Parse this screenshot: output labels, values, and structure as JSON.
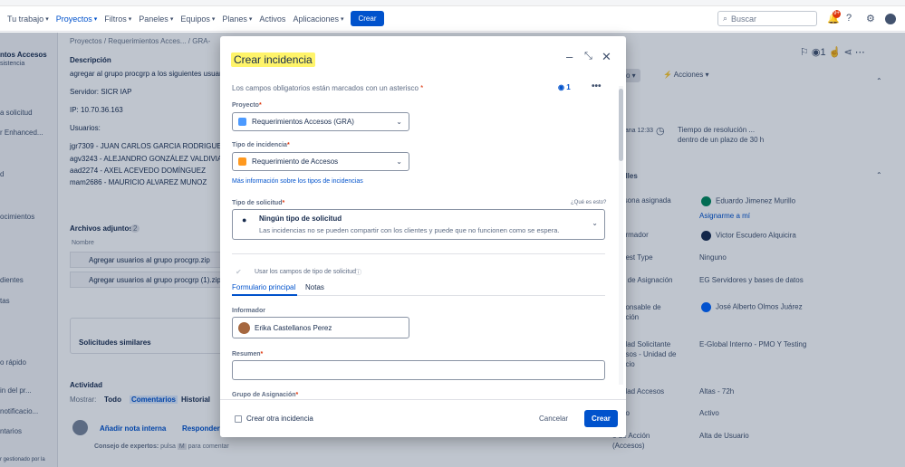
{
  "topnav": {
    "items": [
      "Tu trabajo",
      "Proyectos",
      "Filtros",
      "Paneles",
      "Equipos",
      "Planes",
      "Activos",
      "Aplicaciones"
    ],
    "create_label": "Crear",
    "search_placeholder": "Buscar",
    "notif_count": "9+"
  },
  "left_sidebar": {
    "items": [
      "ntos Accesos",
      "sistencia",
      "a solicitud",
      "r Enhanced...",
      "d",
      "ocimientos",
      "dientes",
      "tas",
      "o rápido",
      "in del pr...",
      "notificacio...",
      "ntarios",
      "r gestionado por la"
    ]
  },
  "main": {
    "breadcrumb": [
      "Proyectos",
      "/",
      "Requerimientos Acces...",
      "/",
      "GRA-"
    ],
    "description_label": "Descripción",
    "description_lines": [
      "agregar al grupo procgrp a los siguientes usuario",
      "Servidor: SICR IAP",
      "IP: 10.70.36.163",
      "Usuarios:",
      "jgr7309 -  JUAN CARLOS GARCIA RODRIGUEZ",
      "agv3243 - ALEJANDRO GONZÁLEZ VALDIVIA",
      "aad2274 - AXEL ACEVEDO DOMÍNGUEZ",
      "mam2686 - MAURICIO ALVAREZ MUNOZ"
    ],
    "attachments_label": "Archivos adjuntos",
    "attachments_count": "2",
    "attachments_col": "Nombre",
    "attachments": [
      "Agregar usuarios al grupo procgrp.zip",
      "Agregar usuarios al grupo procgrp (1).zip"
    ],
    "similar_label": "Solicitudes similares",
    "activity_label": "Actividad",
    "show_label": "Mostrar:",
    "filters": [
      "Todo",
      "Comentarios",
      "Historial"
    ],
    "add_internal_note": "Añadir nota interna",
    "reply": "Responder",
    "tip_prefix": "Consejo de expertos:",
    "tip_text": "pulsa",
    "tip_key": "M",
    "tip_suffix": "para comentar"
  },
  "right_panel": {
    "actions_label": "Acciones",
    "status_prefix": "vo",
    "sla_time": "ñana 12:33",
    "sla_title": "Tiempo de resolución ...",
    "sla_sub": "dentro de un plazo de 30 h",
    "details_label": "alles",
    "rows": [
      {
        "label": "rsona asignada",
        "value": "Eduardo Jimenez Murillo"
      },
      {
        "label": "",
        "value": "Asignarme a mí"
      },
      {
        "label": "ormador",
        "value": "Victor Escudero Alquicira"
      },
      {
        "label": "uest Type",
        "value": "Ninguno"
      },
      {
        "label": "o de Asignación",
        "value": "EG Servidores y bases de datos"
      },
      {
        "label": "ponsable de",
        "value": "José Alberto Olmos Juárez"
      },
      {
        "label": "ución",
        "value": ""
      },
      {
        "label": "idad Solicitante",
        "value": "E-Global Interno - PMO Y Testing"
      },
      {
        "label": "esos - Unidad de",
        "value": ""
      },
      {
        "label": "ocio",
        "value": ""
      },
      {
        "label": "idad Accesos",
        "value": "Altas - 72h"
      },
      {
        "label": "do",
        "value": "Activo"
      },
      {
        "label": "o de Acción",
        "value": "Alta de Usuario"
      },
      {
        "label": "(Accesos)",
        "value": ""
      }
    ]
  },
  "modal": {
    "title": "Crear incidencia",
    "required_note": "Los campos obligatorios están marcados con un asterisco",
    "asterisk": "*",
    "watchers": "1",
    "proyecto_label": "Proyecto",
    "proyecto_value": "Requerimientos Accesos (GRA)",
    "tipo_incidencia_label": "Tipo de incidencia",
    "tipo_incidencia_value": "Requerimiento de Accesos",
    "mas_info_link": "Más información sobre los tipos de incidencias",
    "tipo_solicitud_label": "Tipo de solicitud",
    "que_es_esto": "¿Qué es esto?",
    "tipo_solicitud_value": "Ningún tipo de solicitud",
    "tipo_solicitud_sub": "Las incidencias no se pueden compartir con los clientes y puede que no funcionen como se espera.",
    "usar_campos": "Usar los campos de tipo de solicitud",
    "tabs": [
      "Formulario principal",
      "Notas"
    ],
    "informador_label": "Informador",
    "informador_value": "Erika Castellanos Perez",
    "resumen_label": "Resumen",
    "grupo_label": "Grupo de Asignación",
    "crear_otra": "Crear otra incidencia",
    "cancel_label": "Cancelar",
    "create_label": "Crear"
  }
}
